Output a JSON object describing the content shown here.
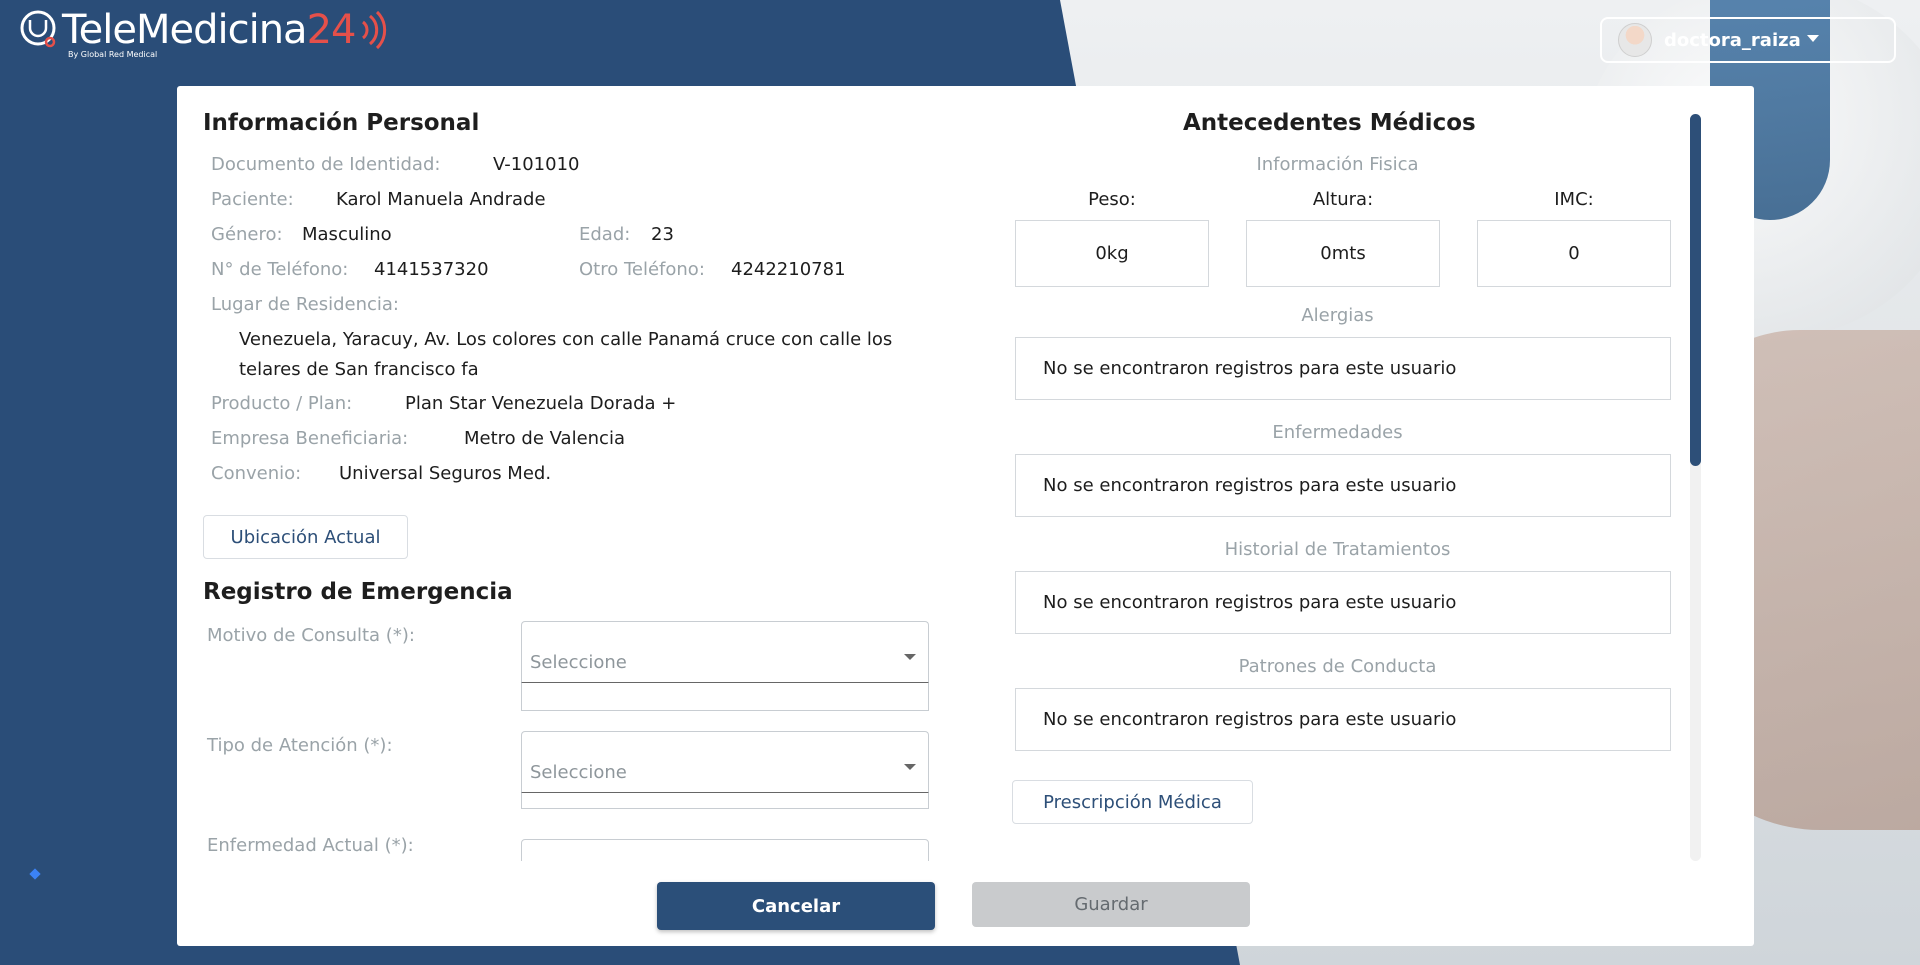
{
  "header": {
    "brand_main": "TeleMedicina",
    "brand_num": "24",
    "brand_sub": "By Global Red Medical",
    "user_name": "doctora_raiza"
  },
  "personal": {
    "title": "Información Personal",
    "fields": {
      "documento_label": "Documento de Identidad:",
      "documento_value": "V-101010",
      "paciente_label": "Paciente:",
      "paciente_value": "Karol Manuela Andrade",
      "genero_label": "Género:",
      "genero_value": "Masculino",
      "edad_label": "Edad:",
      "edad_value": "23",
      "telefono_label": "N° de Teléfono:",
      "telefono_value": "4141537320",
      "otro_tel_label": "Otro Teléfono:",
      "otro_tel_value": "4242210781",
      "residencia_label": "Lugar de Residencia:",
      "residencia_value": "Venezuela, Yaracuy, Av. Los colores con calle Panamá cruce con calle los telares de San francisco fa",
      "producto_label": "Producto / Plan:",
      "producto_value": "Plan Star Venezuela Dorada +",
      "empresa_label": "Empresa Beneficiaria:",
      "empresa_value": "Metro de Valencia",
      "convenio_label": "Convenio:",
      "convenio_value": "Universal Seguros Med."
    },
    "ubicacion_button": "Ubicación Actual"
  },
  "emergency": {
    "title": "Registro de Emergencia",
    "motivo_label": "Motivo de Consulta (*):",
    "motivo_placeholder": "Seleccione",
    "tipo_label": "Tipo de Atención (*):",
    "tipo_placeholder": "Seleccione",
    "enfermedad_label": "Enfermedad Actual (*):"
  },
  "medical": {
    "title": "Antecedentes Médicos",
    "fisica_label": "Información Fisica",
    "peso_label": "Peso:",
    "peso_value": "0kg",
    "altura_label": "Altura:",
    "altura_value": "0mts",
    "imc_label": "IMC:",
    "imc_value": "0",
    "alergias_label": "Alergias",
    "alergias_value": "No se encontraron registros para este usuario",
    "enfermedades_label": "Enfermedades",
    "enfermedades_value": "No se encontraron registros para este usuario",
    "tratamientos_label": "Historial de Tratamientos",
    "tratamientos_value": "No se encontraron registros para este usuario",
    "conducta_label": "Patrones de Conducta",
    "conducta_value": "No se encontraron registros para este usuario",
    "prescripcion_button": "Prescripción Médica"
  },
  "footer": {
    "cancel": "Cancelar",
    "save": "Guardar"
  },
  "colors": {
    "primary": "#2b4f79",
    "accent": "#e5504a",
    "label": "#9aa3a8"
  }
}
